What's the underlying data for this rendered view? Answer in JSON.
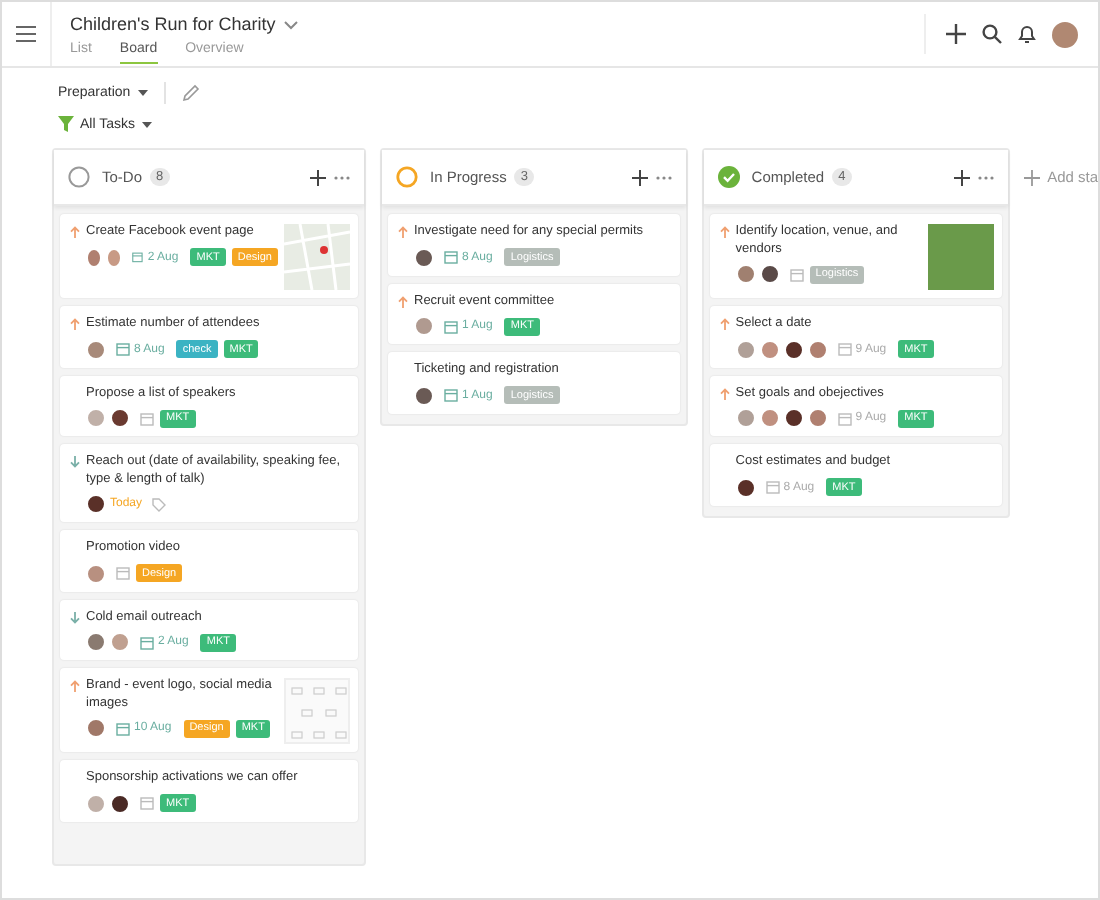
{
  "project": {
    "title": "Children's Run for Charity"
  },
  "tabs": [
    {
      "label": "List",
      "selected": false
    },
    {
      "label": "Board",
      "selected": true
    },
    {
      "label": "Overview",
      "selected": false
    }
  ],
  "section": {
    "label": "Preparation"
  },
  "filter": {
    "label": "All Tasks"
  },
  "columns": [
    {
      "title": "To-Do",
      "count": "8",
      "kind": "todo",
      "cards": [
        {
          "title": "Create Facebook event page",
          "priority_high": true,
          "priority_low": false,
          "avatars": [
            {
              "color": "#b08070"
            },
            {
              "color": "#c89a85"
            }
          ],
          "date": "2 Aug",
          "due_today": false,
          "tags": [
            {
              "label": "MKT",
              "color": "#3dbb7a"
            },
            {
              "label": "Design",
              "color": "#f5a623"
            }
          ],
          "attachment": {
            "kind": "map"
          }
        },
        {
          "title": "Estimate number of attendees",
          "priority_high": true,
          "priority_low": false,
          "avatars": [
            {
              "color": "#a88a7a"
            }
          ],
          "date": "8 Aug",
          "due_today": false,
          "tags": [
            {
              "label": "check",
              "color": "#3bb3c3"
            },
            {
              "label": "MKT",
              "color": "#3dbb7a"
            }
          ]
        },
        {
          "title": "Propose a list of speakers",
          "priority_high": false,
          "priority_low": false,
          "avatars": [
            {
              "color": "#c0b0a8"
            },
            {
              "color": "#6a3a30"
            }
          ],
          "due_today": false,
          "tags": [
            {
              "label": "MKT",
              "color": "#3dbb7a"
            }
          ]
        },
        {
          "title": "Reach out (date of availability, speaking fee, type & length of talk)",
          "priority_high": false,
          "priority_low": true,
          "avatars": [
            {
              "color": "#5a3028"
            }
          ],
          "date": "Today",
          "due_today": true
        },
        {
          "title": "Promotion video",
          "priority_high": false,
          "priority_low": false,
          "avatars": [
            {
              "color": "#b89080"
            }
          ],
          "due_today": false,
          "tags": [
            {
              "label": "Design",
              "color": "#f5a623"
            }
          ]
        },
        {
          "title": "Cold email outreach",
          "priority_high": false,
          "priority_low": true,
          "avatars": [
            {
              "color": "#8a7a70"
            },
            {
              "color": "#c0a090"
            }
          ],
          "date": "2 Aug",
          "due_today": false,
          "tags": [
            {
              "label": "MKT",
              "color": "#3dbb7a"
            }
          ]
        },
        {
          "title": "Brand - event logo, social media images",
          "priority_high": true,
          "priority_low": false,
          "avatars": [
            {
              "color": "#a07868"
            }
          ],
          "date": "10 Aug",
          "due_today": false,
          "tags": [
            {
              "label": "Design",
              "color": "#f5a623"
            },
            {
              "label": "MKT",
              "color": "#3dbb7a"
            }
          ],
          "attachment": {
            "kind": "sketch"
          }
        },
        {
          "title": "Sponsorship activations we can offer",
          "priority_high": false,
          "priority_low": false,
          "avatars": [
            {
              "color": "#c0b0a8"
            },
            {
              "color": "#4a2a25"
            }
          ],
          "due_today": false,
          "tags": [
            {
              "label": "MKT",
              "color": "#3dbb7a"
            }
          ]
        }
      ]
    },
    {
      "title": "In Progress",
      "count": "3",
      "kind": "progress",
      "cards": [
        {
          "title": "Investigate need for any special permits",
          "priority_high": true,
          "priority_low": false,
          "avatars": [
            {
              "color": "#6a5a55"
            }
          ],
          "date": "8 Aug",
          "due_today": false,
          "tags": [
            {
              "label": "Logistics",
              "color": "#b5bdb8"
            }
          ]
        },
        {
          "title": "Recruit event committee",
          "priority_high": true,
          "priority_low": false,
          "avatars": [
            {
              "color": "#b09a90"
            }
          ],
          "date": "1 Aug",
          "due_today": false,
          "tags": [
            {
              "label": "MKT",
              "color": "#3dbb7a"
            }
          ]
        },
        {
          "title": "Ticketing and registration",
          "priority_high": false,
          "priority_low": false,
          "avatars": [
            {
              "color": "#6a5a55"
            }
          ],
          "date": "1 Aug",
          "due_today": false,
          "tags": [
            {
              "label": "Logistics",
              "color": "#b5bdb8"
            }
          ]
        }
      ]
    },
    {
      "title": "Completed",
      "count": "4",
      "kind": "done",
      "cards": [
        {
          "title": "Identify location, venue, and vendors",
          "priority_high": true,
          "priority_low": false,
          "avatars": [
            {
              "color": "#a08070"
            },
            {
              "color": "#5a4a48"
            }
          ],
          "due_today": false,
          "tags": [
            {
              "label": "Logistics",
              "color": "#b5bdb8"
            }
          ],
          "attachment": {
            "kind": "photo"
          }
        },
        {
          "title": "Select a date",
          "priority_high": true,
          "priority_low": false,
          "avatars": [
            {
              "color": "#b0a098"
            },
            {
              "color": "#c09080"
            },
            {
              "color": "#5a3028"
            },
            {
              "color": "#b08070"
            }
          ],
          "date": "9 Aug",
          "due_today": false,
          "tags": [
            {
              "label": "MKT",
              "color": "#3dbb7a"
            }
          ]
        },
        {
          "title": "Set goals and obejectives",
          "priority_high": true,
          "priority_low": false,
          "avatars": [
            {
              "color": "#b0a098"
            },
            {
              "color": "#c09080"
            },
            {
              "color": "#5a3028"
            },
            {
              "color": "#b08070"
            }
          ],
          "date": "9 Aug",
          "due_today": false,
          "tags": [
            {
              "label": "MKT",
              "color": "#3dbb7a"
            }
          ]
        },
        {
          "title": "Cost estimates and budget",
          "priority_high": false,
          "priority_low": false,
          "avatars": [
            {
              "color": "#5a3028"
            }
          ],
          "date": "8 Aug",
          "due_today": false,
          "tags": [
            {
              "label": "MKT",
              "color": "#3dbb7a"
            }
          ]
        }
      ]
    }
  ],
  "add_stage": {
    "label": "Add sta"
  }
}
